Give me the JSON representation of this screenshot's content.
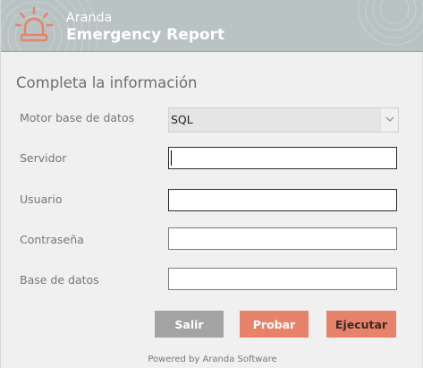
{
  "header": {
    "brand_top": "Aranda",
    "brand_main": "Emergency Report",
    "logo_icon": "alarm-light-icon",
    "background_color": "#b9c3c3",
    "logo_color": "#e8826a"
  },
  "form": {
    "title": "Completa la información",
    "fields": {
      "engine": {
        "label": "Motor base de datos",
        "value": "SQL",
        "arrow_icon": "chevron-down-icon"
      },
      "server": {
        "label": "Servidor",
        "value": ""
      },
      "user": {
        "label": "Usuario",
        "value": ""
      },
      "password": {
        "label": "Contraseña",
        "value": ""
      },
      "database": {
        "label": "Base de datos",
        "value": ""
      }
    }
  },
  "buttons": {
    "exit_label": "Salir",
    "test_label": "Probar",
    "run_label": "Ejecutar",
    "accent_color": "#e8826a",
    "neutral_color": "#a3a3a3"
  },
  "footer": {
    "text": "Powered by Aranda Software"
  }
}
